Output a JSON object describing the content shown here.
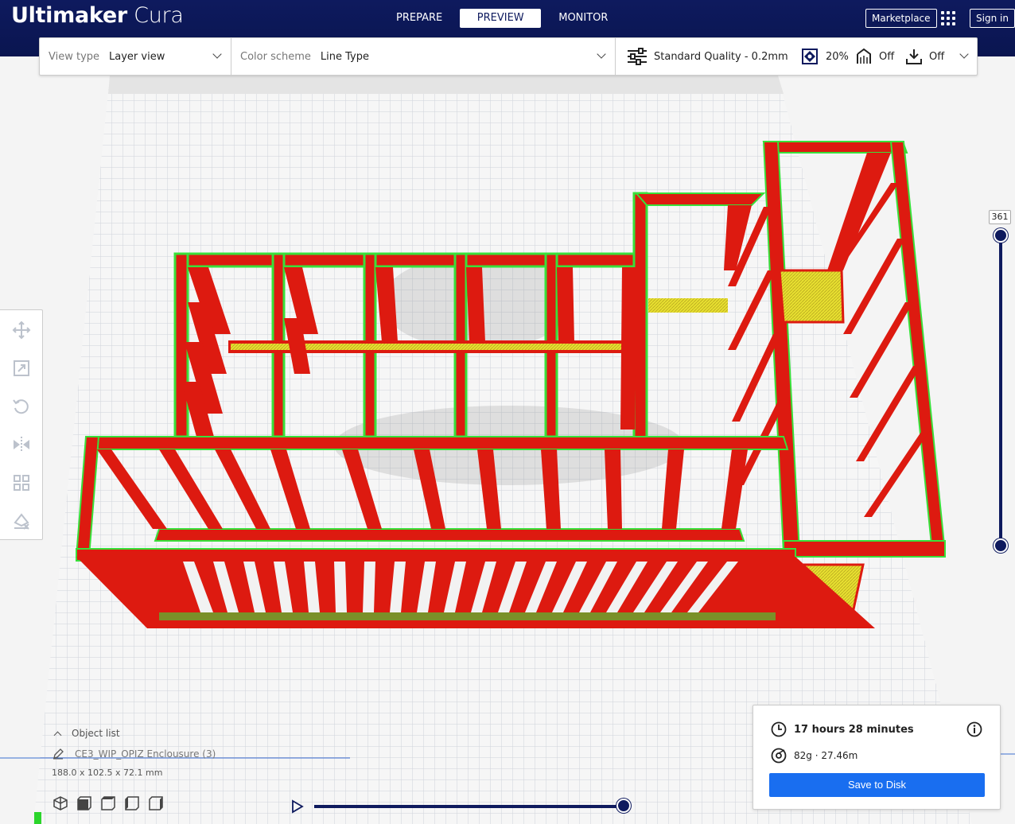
{
  "app": {
    "brand_bold": "Ultimaker",
    "brand_light": "Cura",
    "stages": [
      "PREPARE",
      "PREVIEW",
      "MONITOR"
    ],
    "active_stage": "PREVIEW",
    "marketplace_label": "Marketplace",
    "signin_label": "Sign in"
  },
  "toolbar": {
    "view_type_label": "View type",
    "view_type_value": "Layer view",
    "color_scheme_label": "Color scheme",
    "color_scheme_value": "Line Type",
    "quality": "Standard Quality - 0.2mm",
    "infill": "20%",
    "support": "Off",
    "adhesion": "Off"
  },
  "layer_slider": {
    "current_layer": "361"
  },
  "object_list": {
    "header": "Object list",
    "object_name": "CE3_WIP_OPIZ Enclousure (3)",
    "dimensions": "188.0 x 102.5 x 72.1 mm"
  },
  "print_summary": {
    "time": "17 hours 28 minutes",
    "material": "82g · 27.46m",
    "save_label": "Save to Disk"
  },
  "colors": {
    "header_bg": "#0e1a5e",
    "wall_red": "#dd1a10",
    "infill_yellow": "#e8e030",
    "outer_wall_green": "#39e03a",
    "save_blue": "#196ef0"
  }
}
